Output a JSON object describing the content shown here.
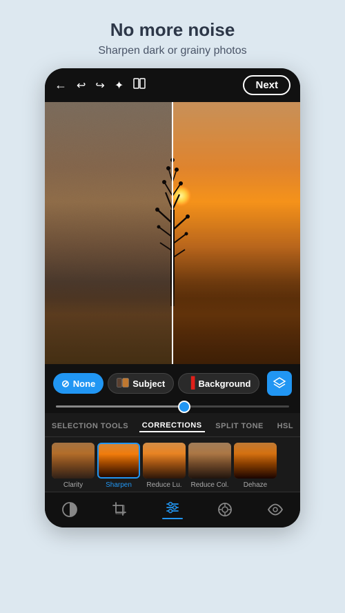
{
  "header": {
    "title": "No more noise",
    "subtitle": "Sharpen dark or grainy photos"
  },
  "toolbar": {
    "next_label": "Next",
    "back_icon": "←",
    "undo_icon": "↩",
    "redo_icon": "↪",
    "magic_icon": "✦",
    "compare_icon": "⧉"
  },
  "selection": {
    "chips": [
      {
        "label": "None",
        "type": "none",
        "icon": "🚫",
        "active": true
      },
      {
        "label": "Subject",
        "type": "subject",
        "active": false
      },
      {
        "label": "Background",
        "type": "background",
        "active": false
      }
    ],
    "layers_icon": "layers"
  },
  "tabs": [
    {
      "label": "SELECTION TOOLS",
      "active": false
    },
    {
      "label": "CORRECTIONS",
      "active": true
    },
    {
      "label": "SPLIT TONE",
      "active": false
    },
    {
      "label": "HSL",
      "active": false
    }
  ],
  "corrections": [
    {
      "label": "Clarity",
      "active": false
    },
    {
      "label": "Sharpen",
      "active": true
    },
    {
      "label": "Reduce Lu.",
      "active": false
    },
    {
      "label": "Reduce Col.",
      "active": false
    },
    {
      "label": "Dehaze",
      "active": false
    }
  ],
  "bottom_nav": [
    {
      "icon": "circle",
      "label": "presets",
      "active": false
    },
    {
      "icon": "crop",
      "label": "crop",
      "active": false
    },
    {
      "icon": "sliders",
      "label": "adjustments",
      "active": true
    },
    {
      "icon": "bandage",
      "label": "healing",
      "active": false
    },
    {
      "icon": "eye",
      "label": "preview",
      "active": false
    }
  ],
  "colors": {
    "accent": "#2196F3",
    "background_dark": "#111111",
    "chip_none_bg": "#2196F3",
    "tab_active": "#ffffff"
  }
}
